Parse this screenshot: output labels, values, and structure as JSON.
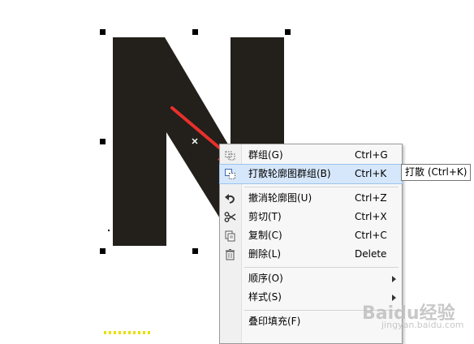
{
  "canvas": {
    "letter_color": "#231f1b",
    "arrow_color": "#e8302a"
  },
  "context_menu": {
    "items": [
      {
        "label": "群组(G)",
        "shortcut": "Ctrl+G",
        "icon": "group-icon"
      },
      {
        "label": "打散轮廓图群组(B)",
        "shortcut": "Ctrl+K",
        "icon": "break-apart-icon"
      },
      {
        "label": "撤消轮廓图(U)",
        "shortcut": "Ctrl+Z",
        "icon": "undo-icon"
      },
      {
        "label": "剪切(T)",
        "shortcut": "Ctrl+X",
        "icon": "scissors-icon"
      },
      {
        "label": "复制(C)",
        "shortcut": "Ctrl+C",
        "icon": "copy-icon"
      },
      {
        "label": "删除(L)",
        "shortcut": "Delete",
        "icon": "trash-icon"
      },
      {
        "label": "顺序(O)",
        "shortcut": "",
        "icon": ""
      },
      {
        "label": "样式(S)",
        "shortcut": "",
        "icon": ""
      },
      {
        "label": "叠印填充(F)",
        "shortcut": "",
        "icon": ""
      }
    ]
  },
  "tooltip": {
    "text": "打散 (Ctrl+K)"
  },
  "watermark": {
    "text": "Baidu经验",
    "sub": "jingyan.baidu.com"
  }
}
